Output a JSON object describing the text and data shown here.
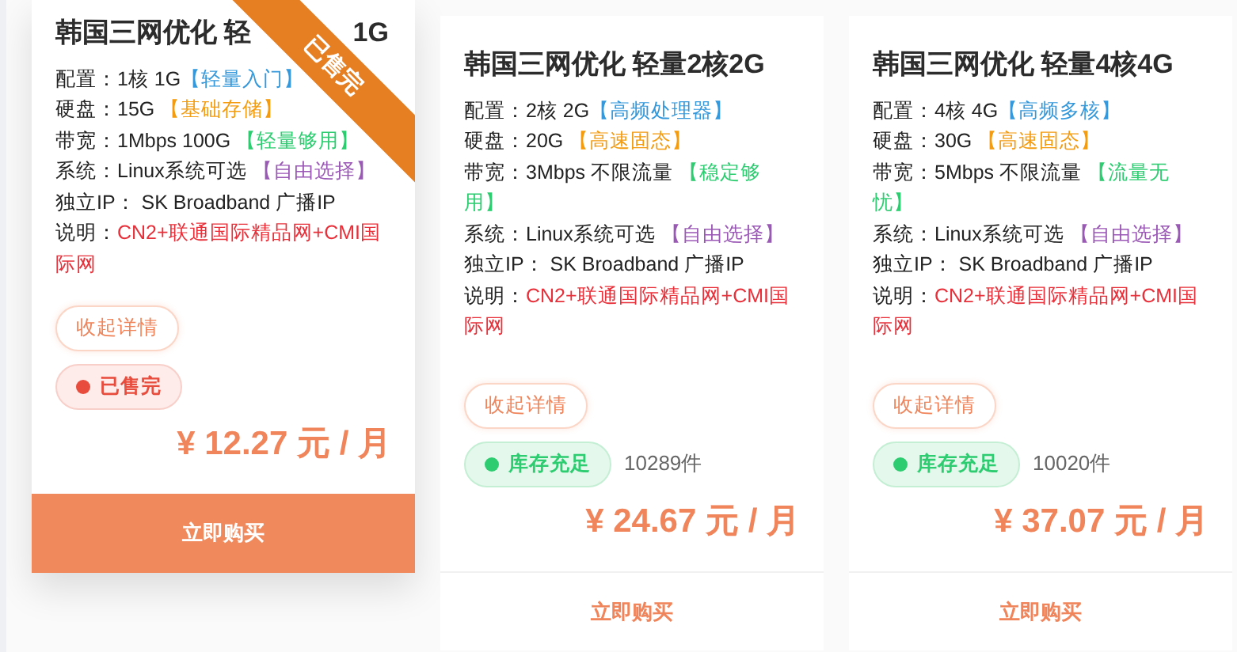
{
  "cards": [
    {
      "title": [
        "韩国三网优化 轻",
        "1G"
      ],
      "highlighted": true,
      "ribbon": "已售完",
      "specs": [
        {
          "label": "配置：",
          "value": "1核 1G",
          "tag": "【轻量入门】",
          "color": "#3498db"
        },
        {
          "label": "硬盘：",
          "value": "15G ",
          "tag": "【基础存储】",
          "color": "#f39c12"
        },
        {
          "label": "带宽：",
          "value": "1Mbps 100G ",
          "tag": "【轻量够用】",
          "color": "#2ecc71"
        },
        {
          "label": "系统：",
          "value": "Linux系统可选 ",
          "tag": "【自由选择】",
          "color": "#9b59b6"
        },
        {
          "label": "独立IP：",
          "value": " SK Broadband 广播IP"
        }
      ],
      "note_label": "说明：",
      "note": "CN2+联通国际精品网+CMI国际网",
      "toggle": "收起详情",
      "status": {
        "kind": "sold_out",
        "text": "已售完"
      },
      "price": "¥ 12.27 元 / 月",
      "buy": "立即购买"
    },
    {
      "title": [
        "韩国三网优化 轻量2核2G"
      ],
      "highlighted": false,
      "specs": [
        {
          "label": "配置：",
          "value": "2核 2G",
          "tag": "【高频处理器】",
          "color": "#3498db"
        },
        {
          "label": "硬盘：",
          "value": "20G ",
          "tag": "【高速固态】",
          "color": "#f39c12"
        },
        {
          "label": "带宽：",
          "value": "3Mbps 不限流量 ",
          "tag": "【稳定够用】",
          "color": "#2ecc71"
        },
        {
          "label": "系统：",
          "value": "Linux系统可选 ",
          "tag": "【自由选择】",
          "color": "#9b59b6"
        },
        {
          "label": "独立IP：",
          "value": " SK Broadband 广播IP"
        }
      ],
      "note_label": "说明：",
      "note": "CN2+联通国际精品网+CMI国际网",
      "toggle": "收起详情",
      "status": {
        "kind": "in_stock",
        "text": "库存充足"
      },
      "stock": "10289件",
      "price": "¥ 24.67 元 / 月",
      "buy": "立即购买"
    },
    {
      "title": [
        "韩国三网优化 轻量4核4G"
      ],
      "highlighted": false,
      "specs": [
        {
          "label": "配置：",
          "value": "4核 4G",
          "tag": "【高频多核】",
          "color": "#3498db"
        },
        {
          "label": "硬盘：",
          "value": "30G ",
          "tag": "【高速固态】",
          "color": "#f39c12"
        },
        {
          "label": "带宽：",
          "value": "5Mbps 不限流量 ",
          "tag": "【流量无忧】",
          "color": "#2ecc71"
        },
        {
          "label": "系统：",
          "value": "Linux系统可选 ",
          "tag": "【自由选择】",
          "color": "#9b59b6"
        },
        {
          "label": "独立IP：",
          "value": " SK Broadband 广播IP"
        }
      ],
      "note_label": "说明：",
      "note": "CN2+联通国际精品网+CMI国际网",
      "toggle": "收起详情",
      "status": {
        "kind": "in_stock",
        "text": "库存充足"
      },
      "stock": "10020件",
      "price": "¥ 37.07 元 / 月",
      "buy": "立即购买"
    }
  ]
}
